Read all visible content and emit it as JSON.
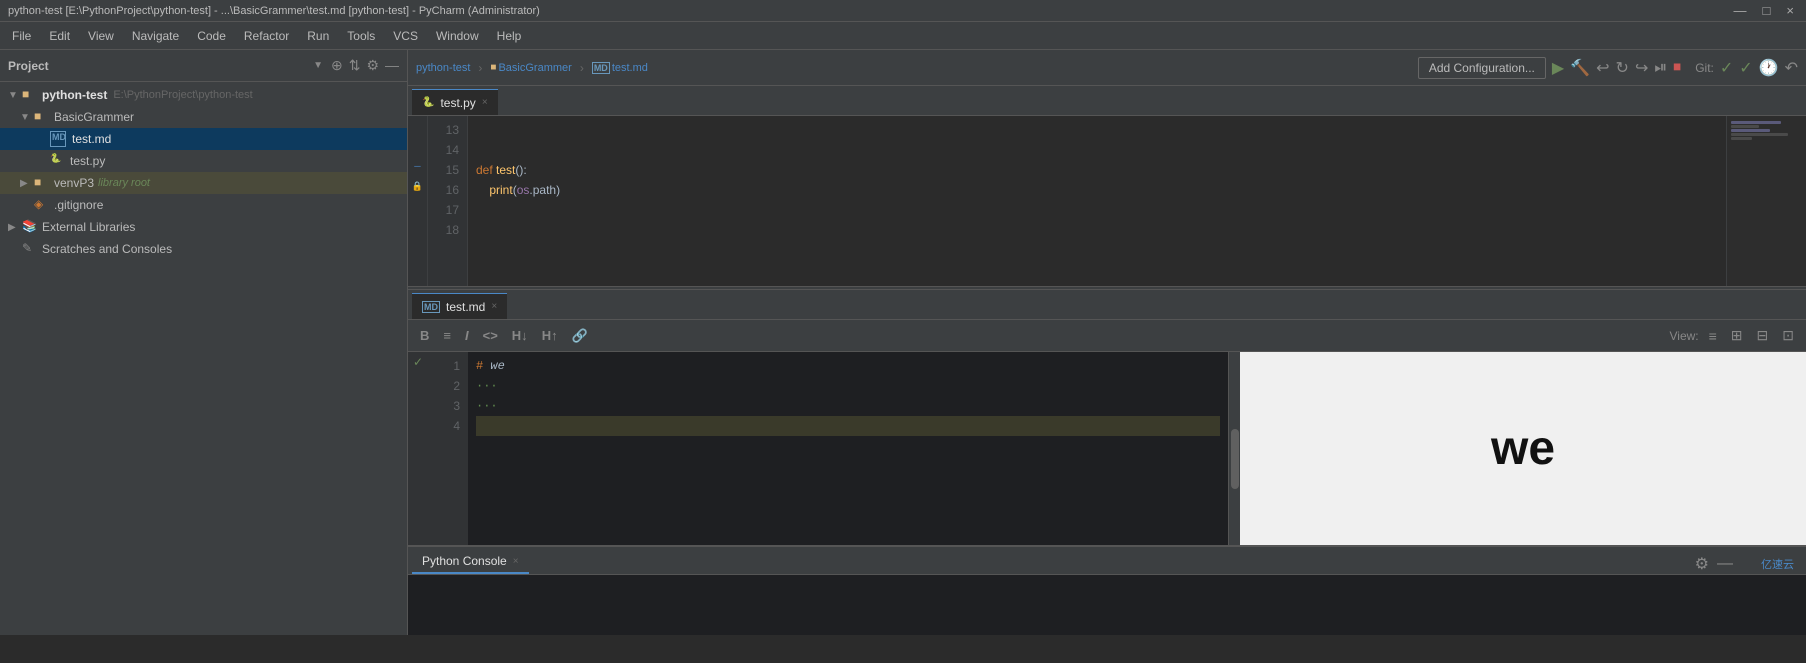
{
  "titlebar": {
    "text": "python-test [E:\\PythonProject\\python-test] - ...\\BasicGrammer\\test.md [python-test] - PyCharm (Administrator)"
  },
  "menubar": {
    "items": [
      "File",
      "Edit",
      "View",
      "Navigate",
      "Code",
      "Refactor",
      "Run",
      "Tools",
      "VCS",
      "Window",
      "Help"
    ]
  },
  "breadcrumb": {
    "parts": [
      "python-test",
      "BasicGrammer",
      "test.md"
    ]
  },
  "toolbar": {
    "add_config_label": "Add Configuration...",
    "git_label": "Git:",
    "run_icons": [
      "▶",
      "🔨",
      "↩",
      "↻",
      "↪",
      "⏯",
      "⏹"
    ],
    "undo_icon": "↶"
  },
  "sidebar": {
    "title": "Project",
    "icons": [
      "⊕",
      "⇅",
      "⚙",
      "—"
    ],
    "items": [
      {
        "label": "python-test",
        "sub": "E:\\PythonProject\\python-test",
        "indent": 0,
        "type": "folder",
        "expanded": true,
        "arrow": "▼"
      },
      {
        "label": "BasicGrammer",
        "indent": 1,
        "type": "folder",
        "expanded": true,
        "arrow": "▼"
      },
      {
        "label": "test.md",
        "indent": 2,
        "type": "md",
        "selected": true
      },
      {
        "label": "test.py",
        "indent": 2,
        "type": "py"
      },
      {
        "label": "venvP3",
        "indent": 1,
        "type": "folder",
        "expanded": false,
        "arrow": "▶",
        "tag": "library root"
      },
      {
        "label": ".gitignore",
        "indent": 1,
        "type": "git"
      },
      {
        "label": "External Libraries",
        "indent": 0,
        "type": "folder",
        "expanded": false,
        "arrow": "▶"
      },
      {
        "label": "Scratches and Consoles",
        "indent": 0,
        "type": "folder",
        "expanded": false,
        "arrow": ""
      }
    ]
  },
  "editor_tabs": [
    {
      "label": "test.py",
      "type": "py",
      "active": true
    },
    {
      "label": "test.md",
      "type": "md",
      "active": false
    }
  ],
  "code_editor": {
    "lines": [
      {
        "num": 13,
        "content": ""
      },
      {
        "num": 14,
        "content": ""
      },
      {
        "num": 15,
        "content": "def test():"
      },
      {
        "num": 16,
        "content": "    print(os.path)"
      },
      {
        "num": 17,
        "content": ""
      },
      {
        "num": 18,
        "content": ""
      }
    ]
  },
  "md_tabs": [
    {
      "label": "test.md",
      "type": "md",
      "active": true
    }
  ],
  "md_toolbar": {
    "buttons": [
      "B",
      "≡",
      "I",
      "<>",
      "H↓",
      "H↑",
      "🔗"
    ],
    "view_label": "View:",
    "view_buttons": [
      "≡",
      "⊞",
      "⊟",
      "⊡"
    ]
  },
  "md_editor": {
    "lines": [
      {
        "num": 1,
        "content": "# we",
        "type": "h1",
        "gutter": "check"
      },
      {
        "num": 2,
        "content": "···",
        "type": "code"
      },
      {
        "num": 3,
        "content": "···",
        "type": "code"
      },
      {
        "num": 4,
        "content": "",
        "type": "highlight"
      }
    ]
  },
  "md_preview": {
    "content": "we"
  },
  "bottom_panel": {
    "tab_label": "Python Console",
    "tab_close": "×",
    "settings_icon": "⚙",
    "minimize_icon": "—"
  },
  "colors": {
    "accent": "#4a88c7",
    "background": "#2b2b2b",
    "sidebar_bg": "#3c3f41",
    "active_tab": "#2b2b2b",
    "keyword": "#cc7832",
    "string": "#6a8759",
    "function": "#ffc66d"
  }
}
